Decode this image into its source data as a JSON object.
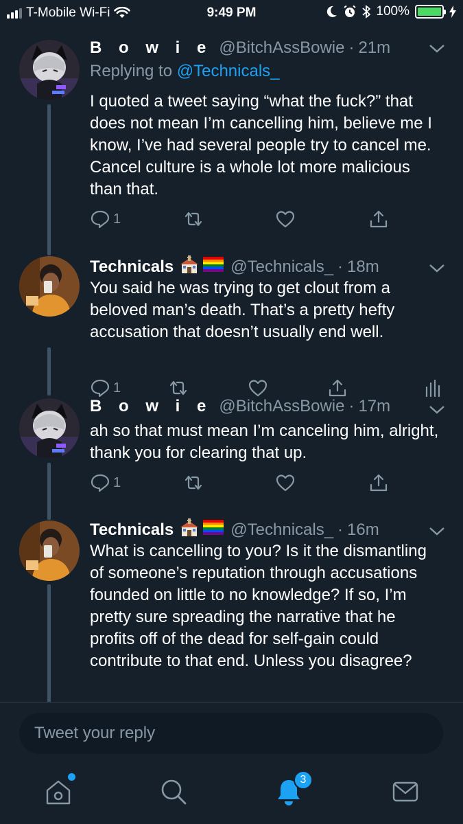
{
  "status_bar": {
    "carrier": "T-Mobile Wi-Fi",
    "time": "9:49 PM",
    "battery": "100%"
  },
  "tweets": [
    {
      "name": "B o w i e",
      "handle": "@BitchAssBowie",
      "sep": "·",
      "time": "21m",
      "replying_prefix": "Replying to",
      "replying_to": "@Technicals_",
      "text": "I quoted a tweet saying “what the fuck?” that does not mean I’m cancelling him, believe me I know, I’ve had several people try to cancel me. Cancel culture is a whole lot more malicious than that.",
      "reply_count": "1"
    },
    {
      "name": "Technicals",
      "emojis": [
        "⛪",
        "🏳️‍🌈"
      ],
      "handle": "@Technicals_",
      "sep": "·",
      "time": "18m",
      "text": "You said he was trying to get clout from a beloved man’s death. That’s a pretty hefty accusation that doesn’t usually end well.",
      "reply_count": "1"
    },
    {
      "name": "B o w i e",
      "handle": "@BitchAssBowie",
      "sep": "·",
      "time": "17m",
      "text": "ah so that must mean I’m canceling him, alright, thank you for clearing that up.",
      "reply_count": "1"
    },
    {
      "name": "Technicals",
      "emojis": [
        "⛪",
        "🏳️‍🌈"
      ],
      "handle": "@Technicals_",
      "sep": "·",
      "time": "16m",
      "text": "What is cancelling to you? Is it the dismantling of someone’s reputation through accusations founded on little to no knowledge? If so, I’m pretty sure spreading the narrative that he profits off of the dead for self-gain could contribute to that end. Unless you disagree?"
    }
  ],
  "reply_box": {
    "placeholder": "Tweet your reply"
  },
  "tabbar": {
    "notifications_badge": "3"
  },
  "colors": {
    "background": "#15202b",
    "secondary_text": "#8899a6",
    "accent": "#1da1f2",
    "thread_line": "#3d5466",
    "battery": "#4cd964"
  },
  "icons": {
    "status": [
      "signal-icon",
      "wifi-icon",
      "moon-icon",
      "alarm-icon",
      "bluetooth-icon",
      "battery-icon",
      "charging-icon"
    ],
    "tweet_actions": [
      "reply-icon",
      "retweet-icon",
      "like-icon",
      "share-icon",
      "analytics-icon"
    ],
    "tabs": [
      "home-icon",
      "search-icon",
      "notifications-icon",
      "messages-icon"
    ]
  }
}
